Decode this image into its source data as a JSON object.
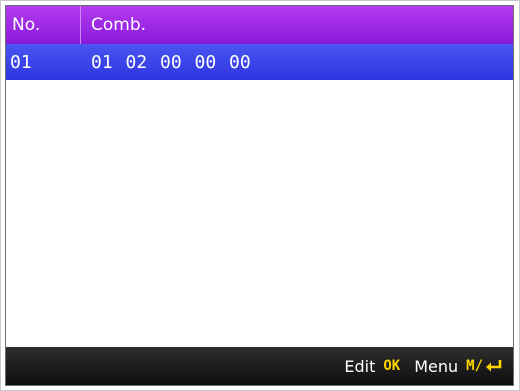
{
  "table": {
    "headers": {
      "no": "No.",
      "comb": "Comb."
    },
    "rows": [
      {
        "no": "01",
        "comb": "01 02 00 00 00"
      }
    ]
  },
  "footer": {
    "edit_label": "Edit",
    "edit_key": "OK",
    "menu_label": "Menu",
    "menu_key": "M/",
    "menu_key_icon": "enter-arrow-icon"
  },
  "colors": {
    "header": "#9b28e4",
    "selected_row": "#3a44ea",
    "footer": "#1c1c1c",
    "key_highlight": "#ffd400"
  }
}
